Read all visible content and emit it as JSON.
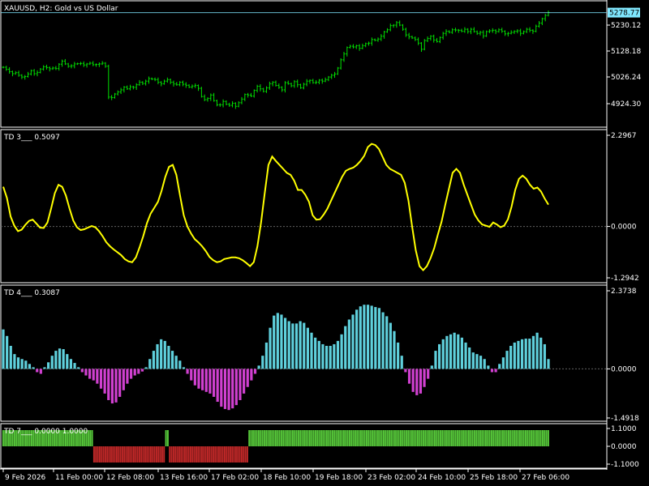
{
  "window": {
    "symbol": "XAUUSD, H2:  Gold vs US Dollar"
  },
  "colors": {
    "background": "#000000",
    "frame": "#ffffff",
    "candle": "#00e000",
    "td3_line": "#ffff00",
    "td4_pos": "#5fd0dc",
    "td4_neg": "#d040d0",
    "td7_pos": "#56c83a",
    "td7_neg": "#c02828",
    "price_tag": "#80e8ff",
    "zero_line": "#606060"
  },
  "chart_data": [
    {
      "type": "line",
      "panel": "price",
      "title": "XAUUSD, H2:  Gold vs US Dollar",
      "yticks": [
        "5230.12",
        "5128.18",
        "5026.24",
        "4924.30"
      ],
      "ylim": [
        4868,
        5290
      ],
      "last_price": "5278.77",
      "close": [
        5066,
        5058,
        5049,
        5041,
        5045,
        5035,
        5028,
        5030,
        5040,
        5053,
        5041,
        5046,
        5059,
        5068,
        5065,
        5060,
        5063,
        5061,
        5078,
        5090,
        5079,
        5070,
        5072,
        5079,
        5080,
        5081,
        5075,
        5079,
        5082,
        5076,
        5077,
        5079,
        5082,
        5070,
        4950,
        4948,
        4962,
        4970,
        4978,
        4989,
        4982,
        4990,
        4988,
        4998,
        5008,
        5003,
        5012,
        5022,
        5020,
        5018,
        5008,
        5002,
        5012,
        5018,
        5008,
        5001,
        4998,
        5008,
        5000,
        4996,
        4989,
        4993,
        4995,
        4984,
        4952,
        4940,
        4945,
        4958,
        4936,
        4920,
        4920,
        4933,
        4922,
        4918,
        4926,
        4914,
        4928,
        4942,
        4960,
        4958,
        4954,
        4976,
        4992,
        4982,
        4972,
        4986,
        5002,
        5008,
        4995,
        4988,
        4978,
        5006,
        5002,
        4994,
        5010,
        4998,
        4986,
        5000,
        5012,
        5015,
        5006,
        5008,
        5016,
        5012,
        5018,
        5028,
        5035,
        5040,
        5063,
        5095,
        5118,
        5143,
        5148,
        5145,
        5150,
        5140,
        5150,
        5158,
        5160,
        5174,
        5171,
        5176,
        5187,
        5204,
        5212,
        5228,
        5230,
        5240,
        5230,
        5214,
        5192,
        5185,
        5180,
        5174,
        5160,
        5136,
        5170,
        5178,
        5187,
        5172,
        5166,
        5182,
        5198,
        5206,
        5202,
        5212,
        5211,
        5210,
        5206,
        5214,
        5205,
        5214,
        5205,
        5198,
        5202,
        5188,
        5205,
        5208,
        5210,
        5205,
        5212,
        5206,
        5196,
        5198,
        5202,
        5206,
        5208,
        5198,
        5205,
        5214,
        5210,
        5206,
        5226,
        5238,
        5255,
        5268,
        5279
      ]
    },
    {
      "type": "line",
      "panel": "TD 3",
      "label": "TD 3___ 0.5097",
      "yticks": [
        "2.2967",
        "0.0000",
        "-1.2942"
      ],
      "ylim": [
        -1.2942,
        2.2967
      ],
      "values": [
        1.0,
        0.72,
        0.25,
        0.02,
        -0.12,
        -0.08,
        0.04,
        0.14,
        0.17,
        0.07,
        -0.03,
        -0.04,
        0.1,
        0.45,
        0.84,
        1.05,
        1.0,
        0.78,
        0.45,
        0.15,
        -0.02,
        -0.09,
        -0.07,
        -0.03,
        0.01,
        -0.02,
        -0.12,
        -0.25,
        -0.4,
        -0.5,
        -0.58,
        -0.65,
        -0.72,
        -0.82,
        -0.88,
        -0.9,
        -0.78,
        -0.53,
        -0.25,
        0.08,
        0.32,
        0.47,
        0.62,
        0.9,
        1.25,
        1.5,
        1.55,
        1.3,
        0.78,
        0.28,
        0.0,
        -0.18,
        -0.32,
        -0.4,
        -0.5,
        -0.62,
        -0.77,
        -0.85,
        -0.9,
        -0.88,
        -0.82,
        -0.8,
        -0.78,
        -0.78,
        -0.8,
        -0.85,
        -0.92,
        -1.0,
        -0.9,
        -0.5,
        0.1,
        0.85,
        1.55,
        1.76,
        1.65,
        1.55,
        1.45,
        1.35,
        1.3,
        1.15,
        0.92,
        0.92,
        0.8,
        0.62,
        0.28,
        0.17,
        0.18,
        0.3,
        0.45,
        0.65,
        0.85,
        1.05,
        1.25,
        1.4,
        1.45,
        1.48,
        1.55,
        1.65,
        1.78,
        2.0,
        2.08,
        2.05,
        1.95,
        1.75,
        1.55,
        1.45,
        1.4,
        1.35,
        1.3,
        1.1,
        0.65,
        0.0,
        -0.6,
        -1.0,
        -1.1,
        -1.0,
        -0.8,
        -0.55,
        -0.2,
        0.12,
        0.55,
        0.95,
        1.35,
        1.45,
        1.35,
        1.05,
        0.8,
        0.55,
        0.3,
        0.15,
        0.05,
        0.02,
        -0.01,
        0.1,
        0.05,
        -0.02,
        0.02,
        0.18,
        0.5,
        0.92,
        1.2,
        1.28,
        1.2,
        1.05,
        0.95,
        0.98,
        0.88,
        0.7,
        0.55
      ]
    },
    {
      "type": "bar",
      "panel": "TD 4",
      "label": "TD 4___ 0.3087",
      "yticks": [
        "2.3738",
        "0.0000",
        "-1.4918"
      ],
      "ylim": [
        -1.4918,
        2.3738
      ],
      "values": [
        1.2,
        1.0,
        0.7,
        0.45,
        0.35,
        0.3,
        0.25,
        0.15,
        0.05,
        -0.1,
        -0.15,
        0.05,
        0.2,
        0.4,
        0.55,
        0.62,
        0.6,
        0.45,
        0.3,
        0.18,
        0.05,
        -0.1,
        -0.2,
        -0.3,
        -0.35,
        -0.45,
        -0.6,
        -0.75,
        -0.95,
        -1.05,
        -1.02,
        -0.85,
        -0.65,
        -0.45,
        -0.3,
        -0.2,
        -0.15,
        -0.08,
        0.05,
        0.3,
        0.55,
        0.75,
        0.9,
        0.85,
        0.7,
        0.55,
        0.4,
        0.25,
        0.05,
        -0.15,
        -0.35,
        -0.5,
        -0.6,
        -0.65,
        -0.7,
        -0.75,
        -0.85,
        -1.0,
        -1.15,
        -1.22,
        -1.25,
        -1.2,
        -1.1,
        -0.95,
        -0.75,
        -0.55,
        -0.35,
        -0.15,
        0.1,
        0.4,
        0.8,
        1.25,
        1.62,
        1.7,
        1.65,
        1.55,
        1.45,
        1.38,
        1.38,
        1.45,
        1.4,
        1.25,
        1.1,
        0.95,
        0.85,
        0.75,
        0.7,
        0.7,
        0.75,
        0.85,
        1.05,
        1.3,
        1.5,
        1.65,
        1.8,
        1.9,
        1.95,
        1.95,
        1.92,
        1.88,
        1.85,
        1.72,
        1.6,
        1.4,
        1.15,
        0.8,
        0.4,
        -0.1,
        -0.45,
        -0.7,
        -0.8,
        -0.75,
        -0.55,
        -0.3,
        0.1,
        0.55,
        0.75,
        0.9,
        1.0,
        1.05,
        1.1,
        1.05,
        0.95,
        0.8,
        0.65,
        0.5,
        0.45,
        0.4,
        0.3,
        0.1,
        -0.1,
        -0.1,
        0.15,
        0.35,
        0.55,
        0.7,
        0.8,
        0.85,
        0.9,
        0.92,
        0.92,
        1.0,
        1.1,
        0.95,
        0.75,
        0.3
      ]
    },
    {
      "type": "bar",
      "panel": "TD 7",
      "label": "TD 7___ 0.0000 1.0000",
      "yticks": [
        "1.1000",
        "0.0000",
        "-1.1000"
      ],
      "ylim": [
        -1.1,
        1.1
      ],
      "values": [
        1,
        1,
        1,
        1,
        1,
        1,
        1,
        1,
        1,
        1,
        1,
        1,
        1,
        1,
        1,
        1,
        1,
        1,
        1,
        1,
        1,
        1,
        1,
        1,
        1,
        1,
        1,
        1,
        1,
        1,
        1,
        1,
        1,
        1,
        1,
        1,
        1,
        1,
        1,
        1,
        1,
        1,
        1,
        1,
        1,
        1,
        1,
        1,
        -1,
        -1,
        -1,
        -1,
        -1,
        -1,
        -1,
        -1,
        -1,
        -1,
        -1,
        -1,
        -1,
        -1,
        -1,
        -1,
        -1,
        -1,
        -1,
        -1,
        -1,
        -1,
        -1,
        -1,
        -1,
        -1,
        -1,
        -1,
        -1,
        -1,
        -1,
        -1,
        -1,
        -1,
        -1,
        -1,
        -1,
        -1,
        1,
        1,
        -1,
        -1,
        -1,
        -1,
        -1,
        -1,
        -1,
        -1,
        -1,
        -1,
        -1,
        -1,
        -1,
        -1,
        -1,
        -1,
        -1,
        -1,
        -1,
        -1,
        -1,
        -1,
        -1,
        -1,
        -1,
        -1,
        -1,
        -1,
        -1,
        -1,
        -1,
        -1,
        -1,
        -1,
        -1,
        -1,
        -1,
        -1,
        -1,
        -1,
        -1,
        -1,
        1,
        1,
        1,
        1,
        1,
        1,
        1,
        1,
        1,
        1,
        1,
        1,
        1,
        1,
        1,
        1,
        1,
        1,
        1,
        1,
        1,
        1,
        1,
        1,
        1,
        1,
        1,
        1,
        1,
        1,
        1,
        1,
        1,
        1,
        1,
        1,
        1,
        1,
        1,
        1,
        1,
        1,
        1,
        1,
        1,
        1,
        1,
        1,
        1,
        1,
        1,
        1,
        1,
        1,
        1,
        1,
        1,
        1,
        1,
        1,
        1,
        1,
        1,
        1,
        1,
        1,
        1,
        1,
        1,
        1,
        1,
        1,
        1,
        1,
        1,
        1,
        1,
        1,
        1,
        1,
        1,
        1,
        1,
        1,
        1,
        1,
        1,
        1,
        1,
        1,
        1,
        1,
        1,
        1,
        1,
        1,
        1,
        1,
        1,
        1,
        1,
        1,
        1,
        1,
        1,
        1,
        1,
        1,
        1,
        1,
        1,
        1,
        1,
        1,
        1,
        1,
        1,
        1,
        1,
        1,
        1,
        1,
        1,
        1,
        1,
        1,
        1,
        1,
        1,
        1,
        1,
        1,
        1,
        1,
        1,
        1,
        1,
        1,
        1,
        1,
        1,
        1,
        1,
        1,
        1,
        1,
        1,
        1,
        1,
        1,
        1,
        1,
        1,
        1,
        1,
        1,
        1,
        1,
        1
      ]
    }
  ],
  "time_axis": [
    "9 Feb 2026",
    "11 Feb 00:00",
    "12 Feb 08:00",
    "13 Feb 16:00",
    "17 Feb 02:00",
    "18 Feb 10:00",
    "19 Feb 18:00",
    "23 Feb 02:00",
    "24 Feb 10:00",
    "25 Feb 18:00",
    "27 Feb 06:00"
  ]
}
